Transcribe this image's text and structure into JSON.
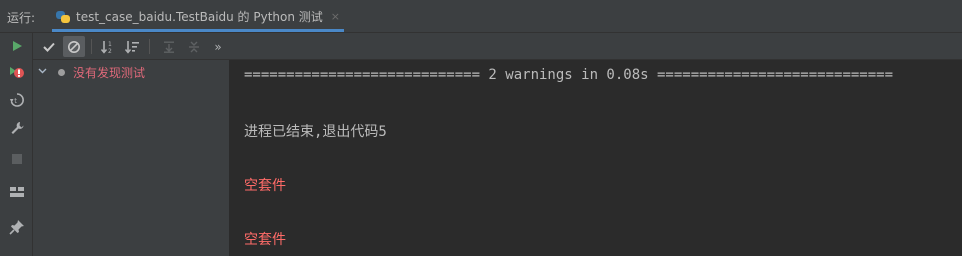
{
  "run_panel": {
    "label": "运行:",
    "tab": {
      "title": "test_case_baidu.TestBaidu 的 Python 测试",
      "close_glyph": "×",
      "icon": "python-test-icon"
    }
  },
  "left_toolbar": {
    "buttons": [
      {
        "name": "rerun-icon",
        "color": "#59a869"
      },
      {
        "name": "rerun-failed-tests-icon",
        "color": "#e05555"
      },
      {
        "name": "toggle-auto-test-icon"
      },
      {
        "name": "wrench-icon"
      },
      {
        "name": "stop-icon"
      },
      {
        "name": "layout-icon"
      },
      {
        "name": "pin-icon"
      }
    ]
  },
  "test_toolbar": {
    "buttons": [
      {
        "name": "show-passed-icon"
      },
      {
        "name": "show-ignored-icon",
        "active": true
      },
      {
        "name": "sort-alphabetically-icon"
      },
      {
        "name": "sort-by-duration-icon"
      },
      {
        "name": "expand-all-icon"
      },
      {
        "name": "collapse-all-icon"
      },
      {
        "name": "more-icon",
        "glyph": "»"
      }
    ]
  },
  "test_tree": {
    "root": {
      "label": "没有发现测试",
      "expanded": true
    }
  },
  "console": {
    "lines": [
      {
        "text": "============================ 2 warnings in 0.08s ============================",
        "kind": "normal"
      },
      {
        "text": "进程已结束,退出代码5",
        "kind": "normal"
      },
      {
        "text": "空套件",
        "kind": "error"
      },
      {
        "text": "空套件",
        "kind": "error"
      }
    ]
  },
  "colors": {
    "background": "#2b2b2b",
    "panel": "#3c3f41",
    "accent": "#4a88c7",
    "error_text": "#ff6b68",
    "tree_error_text": "#e0697a"
  }
}
